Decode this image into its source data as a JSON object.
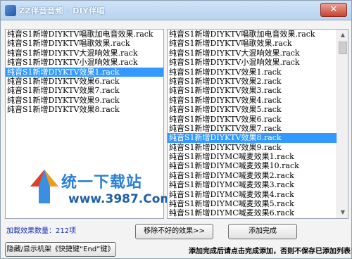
{
  "window": {
    "title": "ZZ伴音音频 · DIY伴唱",
    "close_label": "✕"
  },
  "left_list": {
    "items": [
      "纯音S1新增DIYKTV唱歌加电音效果.rack",
      "纯音S1新增DIYKTV唱歌效果.rack",
      "纯音S1新增DIYKTV大混响效果.rack",
      "纯音S1新增DIYKTV小混响效果.rack",
      "纯音S1新增DIYKTV效果1.rack",
      "纯音S1新增DIYKTV效果6.rack",
      "纯音S1新增DIYKTV效果7.rack",
      "纯音S1新增DIYKTV效果9.rack",
      "纯音S1新增DIYKTV效果8.rack"
    ],
    "selected_index": 4
  },
  "right_list": {
    "items": [
      "纯音S1新增DIYKTV唱歌加电音效果.rack",
      "纯音S1新增DIYKTV唱歌效果.rack",
      "纯音S1新增DIYKTV大混响效果.rack",
      "纯音S1新增DIYKTV小混响效果.rack",
      "纯音S1新增DIYKTV效果1.rack",
      "纯音S1新增DIYKTV效果2.rack",
      "纯音S1新增DIYKTV效果3.rack",
      "纯音S1新增DIYKTV效果4.rack",
      "纯音S1新增DIYKTV效果5.rack",
      "纯音S1新增DIYKTV效果6.rack",
      "纯音S1新增DIYKTV效果7.rack",
      "纯音S1新增DIYKTV效果8.rack",
      "纯音S1新增DIYKTV效果9.rack",
      "纯音S1新增DIYMC喊麦效果1.rack",
      "纯音S1新增DIYMC喊麦效果10.rack",
      "纯音S1新增DIYMC喊麦效果2.rack",
      "纯音S1新增DIYMC喊麦效果3.rack",
      "纯音S1新增DIYMC喊麦效果4.rack",
      "纯音S1新增DIYMC喊麦效果5.rack",
      "纯音S1新增DIYMC喊麦效果6.rack"
    ],
    "selected_index": 11
  },
  "scrollbar": {
    "up_icon": "▲",
    "down_icon": "▼"
  },
  "watermark": {
    "main": "统一下载站",
    "sub": "www.3987.Com"
  },
  "footer": {
    "count_label": "加载效果数量：212项",
    "remove_button": "移除不好的效果>>",
    "finish_button": "添加完成",
    "toggle_button": "隐藏/显示机架《快捷键“End”键》",
    "notice": "添加完成后请点击完成添加，否则不保存已添加列表！"
  },
  "colors": {
    "selection": "#3399ff",
    "count_label": "#1a2fb0",
    "watermark": "#2a7fd6"
  },
  "icons": {
    "app": "app-logo-icon",
    "close": "close-icon",
    "watermark_logo": "download-site-logo-icon"
  }
}
